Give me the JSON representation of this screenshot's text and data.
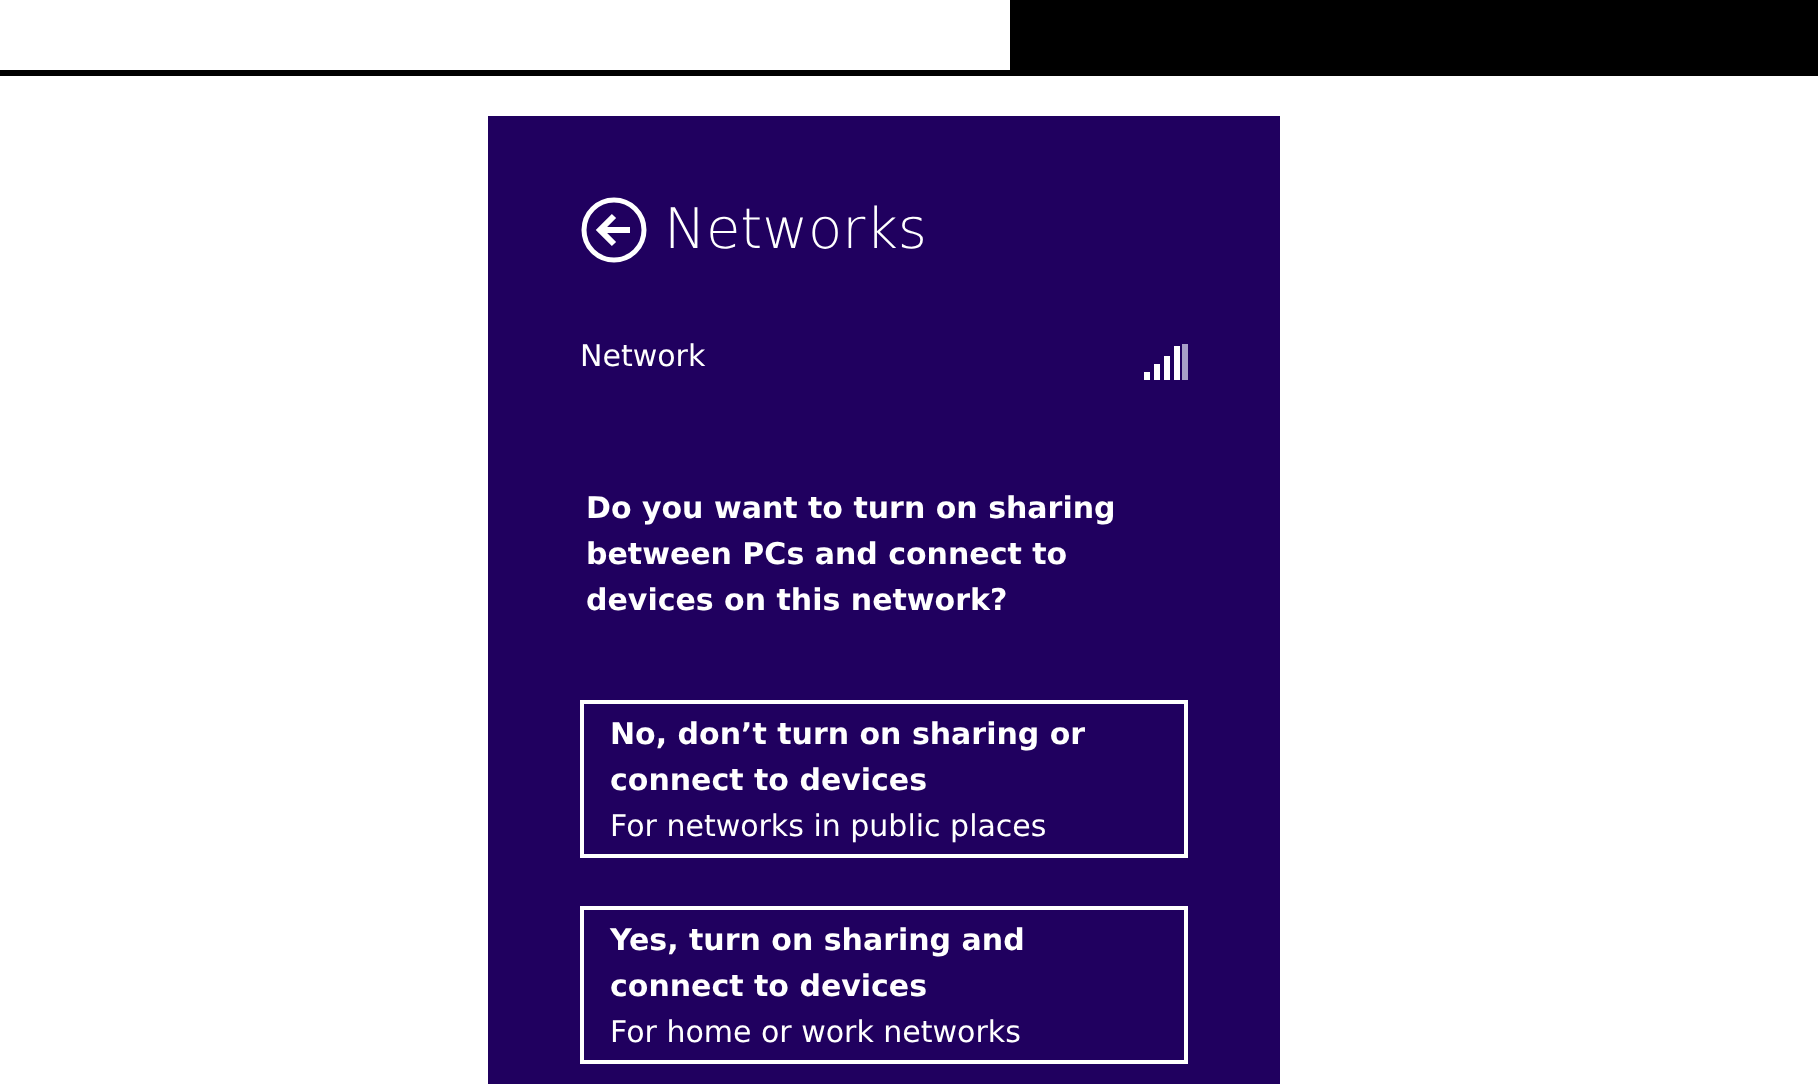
{
  "panel": {
    "title": "Networks",
    "network_name": "Network",
    "question": "Do you want to turn on sharing between PCs and connect to devices on this network?",
    "options": [
      {
        "title": "No, don’t turn on sharing or connect to devices",
        "subtitle": "For networks in public places"
      },
      {
        "title": "Yes, turn on sharing and connect to devices",
        "subtitle": "For home or work networks"
      }
    ]
  }
}
